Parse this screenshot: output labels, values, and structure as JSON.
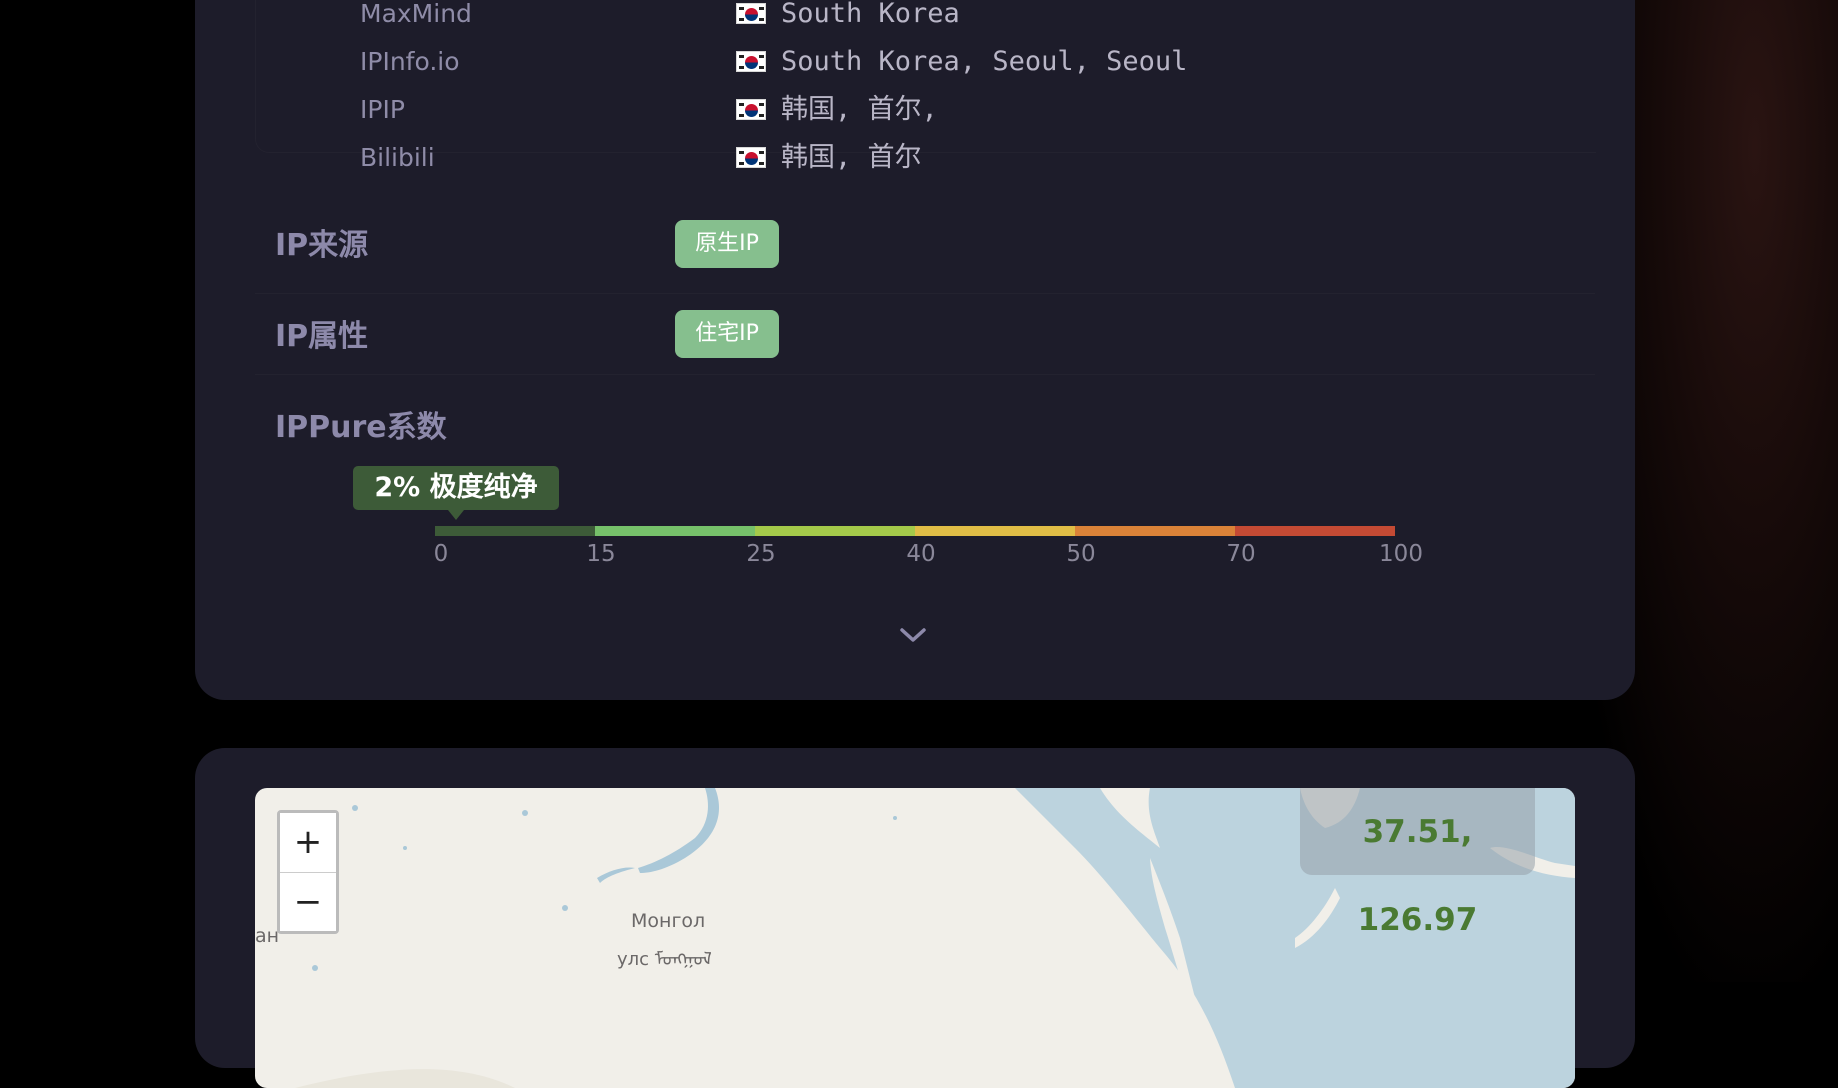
{
  "geo_sources": [
    {
      "source": "MaxMind",
      "value": "South Korea",
      "flag_icon": "south-korea-flag-icon"
    },
    {
      "source": "IPInfo.io",
      "value": "South Korea, Seoul, Seoul",
      "flag_icon": "south-korea-flag-icon"
    },
    {
      "source": "IPIP",
      "value": "韩国, 首尔,",
      "flag_icon": "south-korea-flag-icon"
    },
    {
      "source": "Bilibili",
      "value": "韩国, 首尔",
      "flag_icon": "south-korea-flag-icon"
    }
  ],
  "ip_source": {
    "label": "IP来源",
    "badge": "原生IP",
    "badge_color": "#86bf8e"
  },
  "ip_type": {
    "label": "IP属性",
    "badge": "住宅IP",
    "badge_color": "#86bf8e"
  },
  "ippure": {
    "label": "IPPure系数",
    "score_text": "2% 极度纯净",
    "score_value": 2,
    "tooltip_color": "#3d5b38",
    "scale": {
      "ticks": [
        "0",
        "15",
        "25",
        "40",
        "50",
        "70",
        "100"
      ],
      "breakpoints": [
        0,
        15,
        25,
        40,
        50,
        70,
        100
      ],
      "segment_colors": [
        "#3d5b38",
        "#76c06a",
        "#a4c94a",
        "#e0bd46",
        "#da8238",
        "#c44a34"
      ]
    }
  },
  "expand_icon": "chevron-down-icon",
  "map": {
    "zoom_in_label": "+",
    "zoom_out_label": "−",
    "coordinates": "37.51, 126.97",
    "labels": [
      "Монгол",
      "улс ᠮᠣᠩᠭᠣᠯ",
      "ан"
    ]
  }
}
